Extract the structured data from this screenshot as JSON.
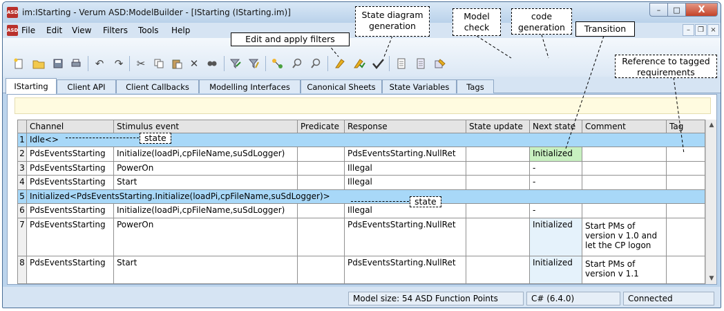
{
  "window": {
    "title": "im:IStarting - Verum ASD:ModelBuilder - [IStarting (IStarting.im)]",
    "app_icon": "ASD",
    "min_label": "–",
    "max_label": "□",
    "close_label": "X"
  },
  "menu": {
    "items": [
      "File",
      "Edit",
      "View",
      "Filters",
      "Tools",
      "Help"
    ],
    "mdi": [
      "–",
      "❐",
      "×"
    ]
  },
  "toolbar": {
    "icons": [
      "new-file-icon",
      "open-folder-icon",
      "save-icon",
      "print-icon",
      "undo-icon",
      "redo-icon",
      "cut-icon",
      "copy-icon",
      "paste-icon",
      "delete-icon",
      "find-icon",
      "edit-filter-icon",
      "apply-filter-icon",
      "state-diagram-icon",
      "zoom-in-icon",
      "zoom-out-icon",
      "check-model-icon",
      "check-edit-icon",
      "model-check-icon",
      "code-gen-icon",
      "code-gen2-icon",
      "tag-icon"
    ]
  },
  "tabs": [
    "IStarting",
    "Client API",
    "Client Callbacks",
    "Modelling Interfaces",
    "Canonical Sheets",
    "State Variables",
    "Tags"
  ],
  "table": {
    "headers": [
      "Channel",
      "Stimulus event",
      "Predicate",
      "Response",
      "State update",
      "Next state",
      "Comment",
      "Tag"
    ],
    "rows": [
      {
        "num": "1",
        "state": "Idle<>"
      },
      {
        "num": "2",
        "channel": "PdsEventsStarting",
        "stimulus": "Initialize(loadPi,cpFileName,suSdLogger)",
        "predicate": "",
        "response": "PdsEventsStarting.NullRet",
        "update": "",
        "next": "Initialized",
        "comment": "",
        "tag": ""
      },
      {
        "num": "3",
        "channel": "PdsEventsStarting",
        "stimulus": "PowerOn",
        "predicate": "",
        "response": "Illegal",
        "update": "",
        "next": "-",
        "comment": "",
        "tag": ""
      },
      {
        "num": "4",
        "channel": "PdsEventsStarting",
        "stimulus": "Start",
        "predicate": "",
        "response": "Illegal",
        "update": "",
        "next": "-",
        "comment": "",
        "tag": ""
      },
      {
        "num": "5",
        "state": "Initialized<PdsEventsStarting.Initialize(loadPi,cpFileName,suSdLogger)>"
      },
      {
        "num": "6",
        "channel": "PdsEventsStarting",
        "stimulus": "Initialize(loadPi,cpFileName,suSdLogger)",
        "predicate": "",
        "response": "Illegal",
        "update": "",
        "next": "-",
        "comment": "",
        "tag": ""
      },
      {
        "num": "7",
        "channel": "PdsEventsStarting",
        "stimulus": "PowerOn",
        "predicate": "",
        "response": "PdsEventsStarting.NullRet",
        "update": "",
        "next": "Initialized",
        "comment": "Start PMs of version v 1.0 and let the CP logon",
        "tag": ""
      },
      {
        "num": "8",
        "channel": "PdsEventsStarting",
        "stimulus": "Start",
        "predicate": "",
        "response": "PdsEventsStarting.NullRet",
        "update": "",
        "next": "Initialized",
        "comment": "Start PMs of version v 1.1",
        "tag": ""
      }
    ]
  },
  "status": {
    "model_size": "Model size: 54 ASD Function Points",
    "version": "C# (6.4.0)",
    "connection": "Connected"
  },
  "callouts": {
    "edit_filters": "Edit and apply filters",
    "state_diagram": "State diagram generation",
    "model_check": "Model check",
    "code_generation": "code generation",
    "transition": "Transition",
    "requirements": "Reference to tagged requirements",
    "state1": "state",
    "state2": "state"
  }
}
